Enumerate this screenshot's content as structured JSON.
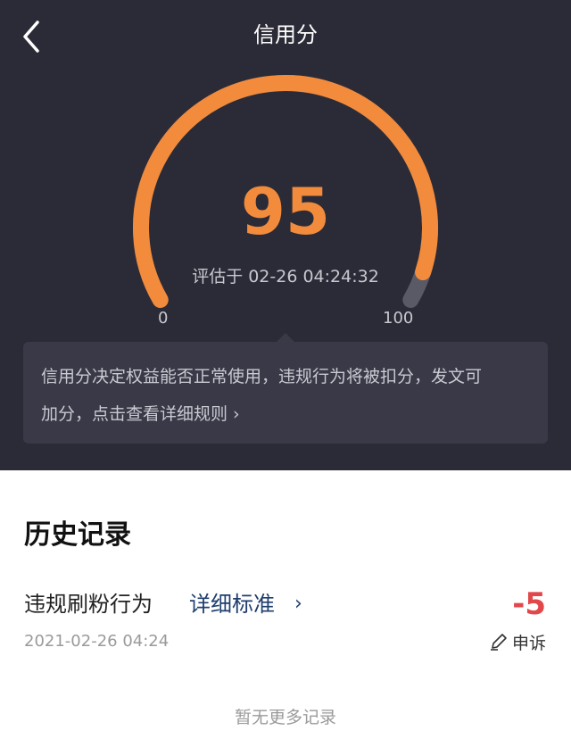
{
  "header": {
    "title": "信用分",
    "back_icon": "back-chevron-icon"
  },
  "gauge": {
    "score": "95",
    "score_value": 95,
    "min_label": "0",
    "max_label": "100",
    "assessed_prefix": "评估于",
    "assessed_time": "02-26 04:24:32",
    "color_fill": "#f28b3c",
    "color_track": "#5a5a66"
  },
  "notice": {
    "line1": "信用分决定权益能否正常使用，违规行为将被扣分，发文可",
    "line2_prefix": "加分，",
    "link_text": "点击查看详细规则 ›"
  },
  "history": {
    "title": "历史记录",
    "records": [
      {
        "reason": "违规刷粉行为",
        "link_label": "详细标准",
        "link_icon": "chevron-right-icon",
        "points": "-5",
        "time": "2021-02-26 04:24",
        "appeal_icon": "pen-icon",
        "appeal_label": "申诉"
      }
    ],
    "end_text": "暂无更多记录"
  },
  "colors": {
    "top_bg": "#2b2b37",
    "deduction": "#e2474b",
    "link": "#1f3e6e"
  }
}
